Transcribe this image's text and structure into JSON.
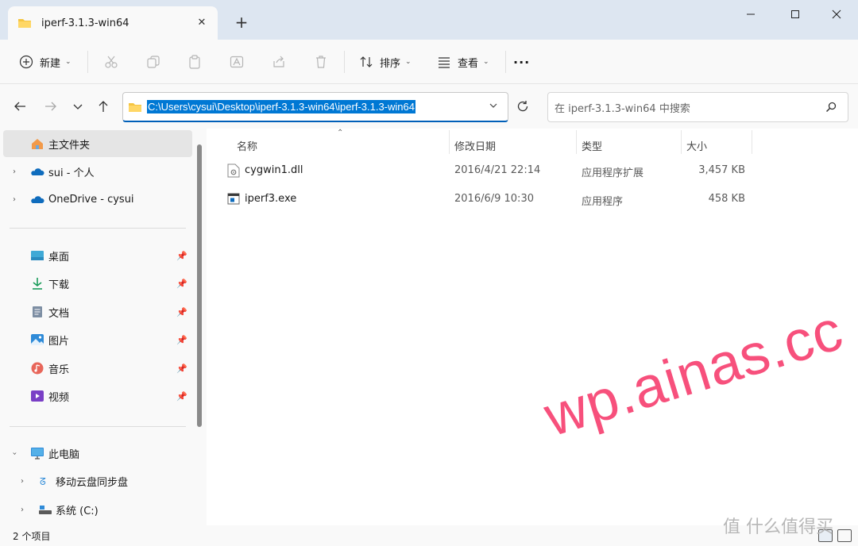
{
  "window": {
    "tab_title": "iperf-3.1.3-win64",
    "tab_close": "✕",
    "new_tab": "+"
  },
  "toolbar": {
    "new_label": "新建",
    "sort_label": "排序",
    "view_label": "查看",
    "more_label": "···"
  },
  "address": {
    "path": "C:\\Users\\cysui\\Desktop\\iperf-3.1.3-win64\\iperf-3.1.3-win64",
    "search_placeholder": "在 iperf-3.1.3-win64 中搜索"
  },
  "sidebar": {
    "items": [
      {
        "label": "主文件夹",
        "icon": "home-icon",
        "selected": true
      },
      {
        "label": "sui - 个人",
        "icon": "onedrive-icon"
      },
      {
        "label": "OneDrive - cysui",
        "icon": "onedrive-icon"
      },
      {
        "label": "桌面",
        "icon": "desktop-icon",
        "pinned": true
      },
      {
        "label": "下载",
        "icon": "download-icon",
        "pinned": true
      },
      {
        "label": "文档",
        "icon": "document-icon",
        "pinned": true
      },
      {
        "label": "图片",
        "icon": "pictures-icon",
        "pinned": true
      },
      {
        "label": "音乐",
        "icon": "music-icon",
        "pinned": true
      },
      {
        "label": "视频",
        "icon": "video-icon",
        "pinned": true
      },
      {
        "label": "此电脑",
        "icon": "pc-icon"
      },
      {
        "label": "移动云盘同步盘",
        "icon": "cloud-drive-icon"
      },
      {
        "label": "系统 (C:)",
        "icon": "drive-icon"
      }
    ]
  },
  "columns": {
    "name": "名称",
    "modified": "修改日期",
    "type": "类型",
    "size": "大小"
  },
  "files": [
    {
      "name": "cygwin1.dll",
      "modified": "2016/4/21 22:14",
      "type": "应用程序扩展",
      "size": "3,457 KB",
      "icon": "dll-file-icon"
    },
    {
      "name": "iperf3.exe",
      "modified": "2016/6/9 10:30",
      "type": "应用程序",
      "size": "458 KB",
      "icon": "exe-file-icon"
    }
  ],
  "status": {
    "item_count": "2 个项目"
  },
  "watermark": {
    "site": "wp.ainas.cc",
    "smzdm": "什么值得买"
  },
  "colors": {
    "accent": "#0078d4",
    "watermark": "#f7507c"
  }
}
